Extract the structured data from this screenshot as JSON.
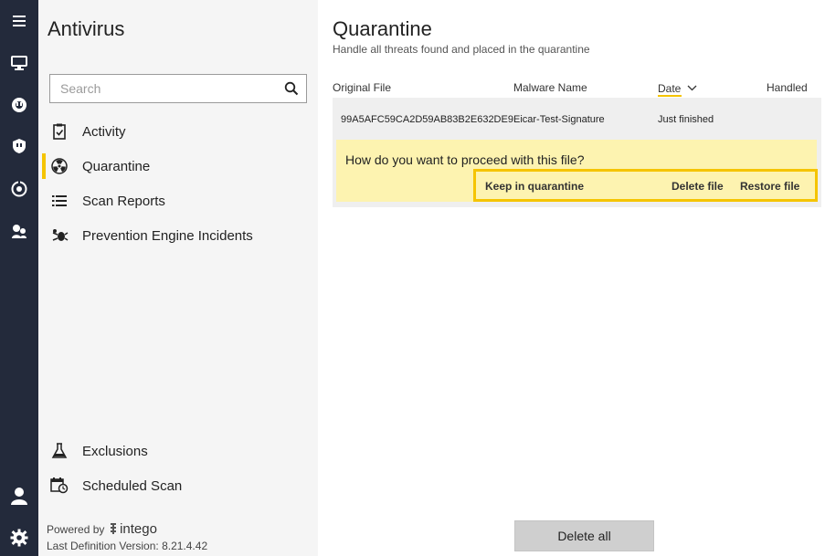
{
  "sidebar": {
    "app_title": "Antivirus",
    "search_placeholder": "Search",
    "nav": [
      {
        "label": "Activity"
      },
      {
        "label": "Quarantine"
      },
      {
        "label": "Scan Reports"
      },
      {
        "label": "Prevention Engine Incidents"
      }
    ],
    "bottom_nav": [
      {
        "label": "Exclusions"
      },
      {
        "label": "Scheduled Scan"
      }
    ],
    "powered_by": "Powered by",
    "brand": "intego",
    "definition_version": "Last Definition Version:  8.21.4.42"
  },
  "rail_icons": [
    "menu-icon",
    "monitor-icon",
    "privacy-icon",
    "shield-icon",
    "network-icon",
    "parental-icon",
    "user-icon",
    "settings-icon"
  ],
  "main": {
    "title": "Quarantine",
    "subtitle": "Handle all threats found and placed in the quarantine",
    "columns": [
      "Original File",
      "Malware Name",
      "Date",
      "Handled"
    ],
    "row": {
      "original_file": "99A5AFC59CA2D59AB83B2E632DE9",
      "malware_name": "Eicar-Test-Signature",
      "date": "Just finished",
      "handled": ""
    },
    "prompt": "How do you want to proceed with this file?",
    "actions": {
      "keep": "Keep in quarantine",
      "delete": "Delete file",
      "restore": "Restore file"
    },
    "delete_all": "Delete all"
  },
  "colors": {
    "rail": "#232a3b",
    "accent": "#f5c400",
    "prompt_bg": "#fdf3b0",
    "sidebar_bg": "#f5f5f5"
  }
}
